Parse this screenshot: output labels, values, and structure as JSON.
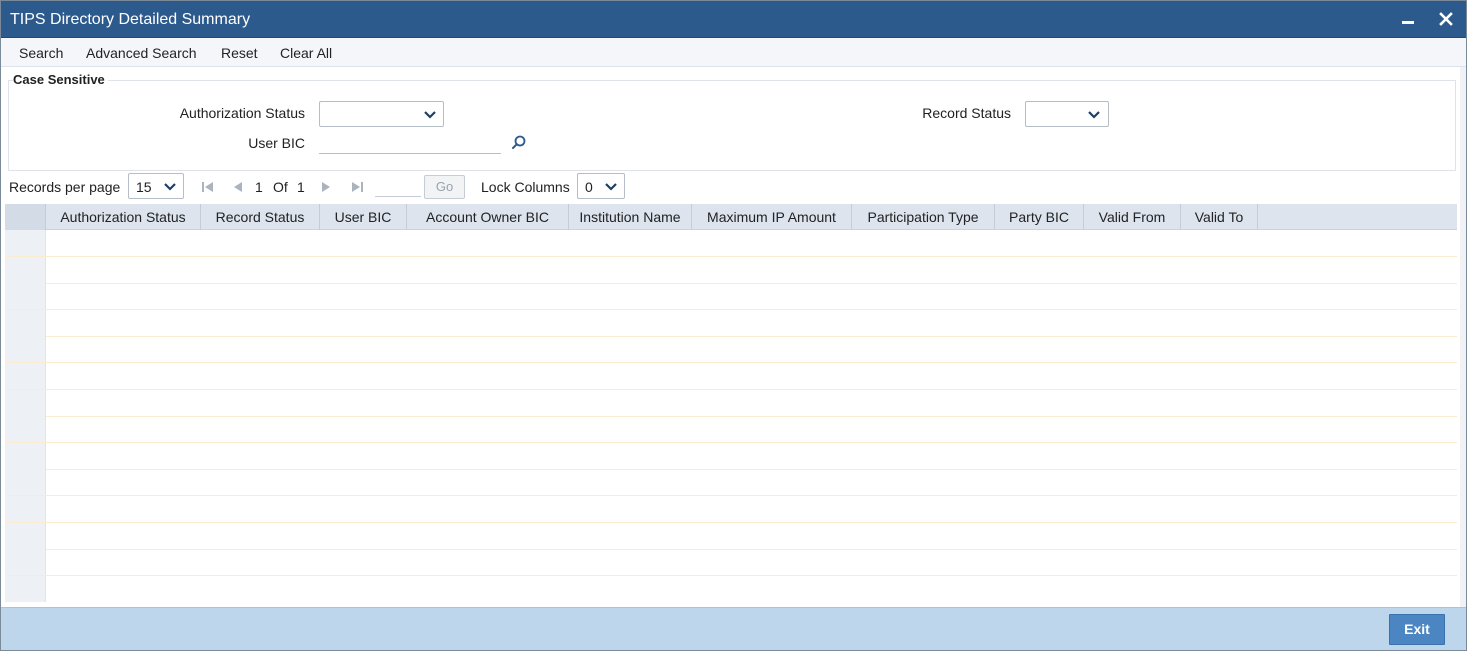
{
  "window": {
    "title": "TIPS Directory Detailed Summary",
    "minimize_icon": "minimize-icon",
    "close_icon": "close-icon"
  },
  "menu": {
    "search": "Search",
    "advanced_search": "Advanced Search",
    "reset": "Reset",
    "clear_all": "Clear All"
  },
  "criteria": {
    "legend": "Case Sensitive",
    "authorization_status_label": "Authorization Status",
    "authorization_status_value": "",
    "record_status_label": "Record Status",
    "record_status_value": "",
    "user_bic_label": "User BIC",
    "user_bic_value": ""
  },
  "pager": {
    "records_per_page_label": "Records per page",
    "records_per_page_value": "15",
    "current_page": "1",
    "of_label": "Of",
    "total_pages": "1",
    "go_label": "Go",
    "lock_columns_label": "Lock Columns",
    "lock_columns_value": "0"
  },
  "grid": {
    "columns": [
      "Authorization Status",
      "Record Status",
      "User BIC",
      "Account Owner BIC",
      "Institution Name",
      "Maximum IP Amount",
      "Participation Type",
      "Party BIC",
      "Valid From",
      "Valid To"
    ],
    "rows": []
  },
  "footer": {
    "exit_label": "Exit"
  },
  "colors": {
    "titlebar": "#2c5a8c",
    "header_row": "#dde4ee",
    "footer": "#bdd6ec",
    "exit_button": "#4b86c2",
    "row_divider": "#fbebcf"
  }
}
